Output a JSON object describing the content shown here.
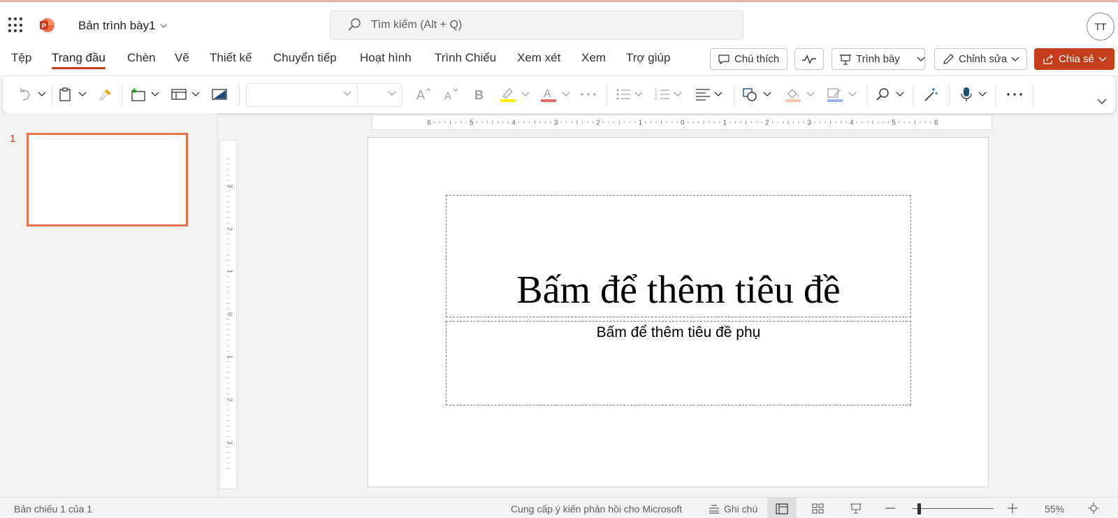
{
  "app": {
    "doc_title": "Bản trình bày1",
    "search_placeholder": "Tìm kiếm (Alt + Q)",
    "user_initials": "TT"
  },
  "tabs": [
    {
      "label": "Tệp"
    },
    {
      "label": "Trang đầu",
      "active": true
    },
    {
      "label": "Chèn"
    },
    {
      "label": "Vẽ"
    },
    {
      "label": "Thiết kế"
    },
    {
      "label": "Chuyển tiếp"
    },
    {
      "label": "Hoạt hình"
    },
    {
      "label": "Trình Chiếu"
    },
    {
      "label": "Xem xét"
    },
    {
      "label": "Xem"
    },
    {
      "label": "Trợ giúp"
    }
  ],
  "actions": {
    "comment": "Chú thích",
    "present": "Trình bày",
    "editing": "Chỉnh sửa",
    "share": "Chia sẻ"
  },
  "ribbon": {
    "font_name": "",
    "font_size": ""
  },
  "slides": {
    "current_number": "1",
    "title_placeholder": "Bấm để thêm tiêu đề",
    "subtitle_placeholder": "Bấm để thêm tiêu đề phụ"
  },
  "rulers": {
    "horizontal": [
      "6",
      "5",
      "4",
      "3",
      "2",
      "1",
      "0",
      "1",
      "2",
      "3",
      "4",
      "5",
      "6"
    ],
    "vertical": [
      "3",
      "2",
      "1",
      "0",
      "1",
      "2",
      "3"
    ]
  },
  "status": {
    "slide_count": "Bản chiếu 1 của 1",
    "feedback": "Cung cấp ý kiến phản hồi cho Microsoft",
    "notes": "Ghi chú",
    "zoom": "55%"
  },
  "colors": {
    "accent": "#c43e1c",
    "thumbnail_border": "#e9704b"
  }
}
